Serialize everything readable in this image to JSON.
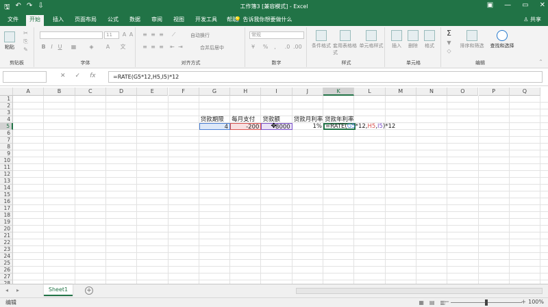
{
  "titlebar": {
    "title": "工作簿3 [兼容模式] - Excel",
    "qat": {
      "save": "🖫",
      "undo": "↶",
      "redo": "↷",
      "customize": "⇩"
    },
    "controls": {
      "minimize": "—",
      "restore": "▭",
      "close": "✕",
      "options": "▣"
    },
    "bg_color": "#217346"
  },
  "tabs": [
    {
      "label": "文件"
    },
    {
      "label": "开始"
    },
    {
      "label": "插入"
    },
    {
      "label": "页面布局"
    },
    {
      "label": "公式"
    },
    {
      "label": "数据"
    },
    {
      "label": "审阅"
    },
    {
      "label": "视图"
    },
    {
      "label": "开发工具"
    },
    {
      "label": "帮助"
    }
  ],
  "tellme": "💡 告诉我你想要做什么",
  "share": "♙ 共享",
  "ribbon": {
    "clipboard": {
      "label": "剪贴板",
      "paste": "粘贴"
    },
    "font": {
      "label": "字体",
      "font_size": "11",
      "bold": "B",
      "italic": "I",
      "underline": "U"
    },
    "alignment": {
      "label": "对齐方式",
      "wrap": "自动换行",
      "merge": "合并后居中"
    },
    "number": {
      "label": "数字",
      "format": "常规",
      "percent": "%",
      "comma": ","
    },
    "styles": {
      "label": "样式",
      "conditional": "条件格式",
      "table": "套用表格格式",
      "cell": "单元格样式"
    },
    "cells": {
      "label": "单元格",
      "insert": "插入",
      "delete": "删除",
      "format": "格式"
    },
    "editing": {
      "label": "编辑",
      "sort": "排序和筛选",
      "find": "查找和选择",
      "sum": "Σ"
    }
  },
  "formula_bar": {
    "cancel": "✕",
    "enter": "✓",
    "fx": "fx",
    "formula": "=RATE(G5*12,H5,I5)*12"
  },
  "columns": [
    "A",
    "B",
    "C",
    "D",
    "E",
    "F",
    "G",
    "H",
    "I",
    "J",
    "K",
    "L",
    "M",
    "N",
    "O",
    "P",
    "Q"
  ],
  "selected_column": "K",
  "rows": [
    "1",
    "2",
    "3",
    "4",
    "5",
    "6",
    "7",
    "8",
    "9",
    "10",
    "11",
    "12",
    "13",
    "14",
    "15",
    "16",
    "17",
    "18",
    "19",
    "20",
    "21",
    "22",
    "23",
    "24",
    "25",
    "26",
    "27",
    "28"
  ],
  "selected_row": "5",
  "cells": {
    "G4": "贷款期限",
    "H4": "每月支付",
    "I4": "贷款额",
    "J4": "贷款月利率",
    "K4": "贷款年利率",
    "G5": "4",
    "H5": "-200",
    "I5": "8000",
    "J5": "1%",
    "K5_parts": [
      "=RATE(",
      "G5",
      "*12,",
      "H5",
      ",",
      "I5",
      ")*12"
    ]
  },
  "ref_colors": {
    "G5": "#4a7fd4",
    "H5": "#d9534f",
    "I5": "#7b52c9"
  },
  "sheet_tabs": [
    {
      "label": "Sheet1"
    }
  ],
  "add_sheet": "+",
  "sheet_nav": {
    "prev": "◂",
    "next": "▸"
  },
  "status": {
    "mode": "编辑",
    "views": [
      "▦",
      "▤",
      "▥"
    ],
    "zoom": "100%",
    "zoom_minus": "−",
    "zoom_plus": "+"
  }
}
